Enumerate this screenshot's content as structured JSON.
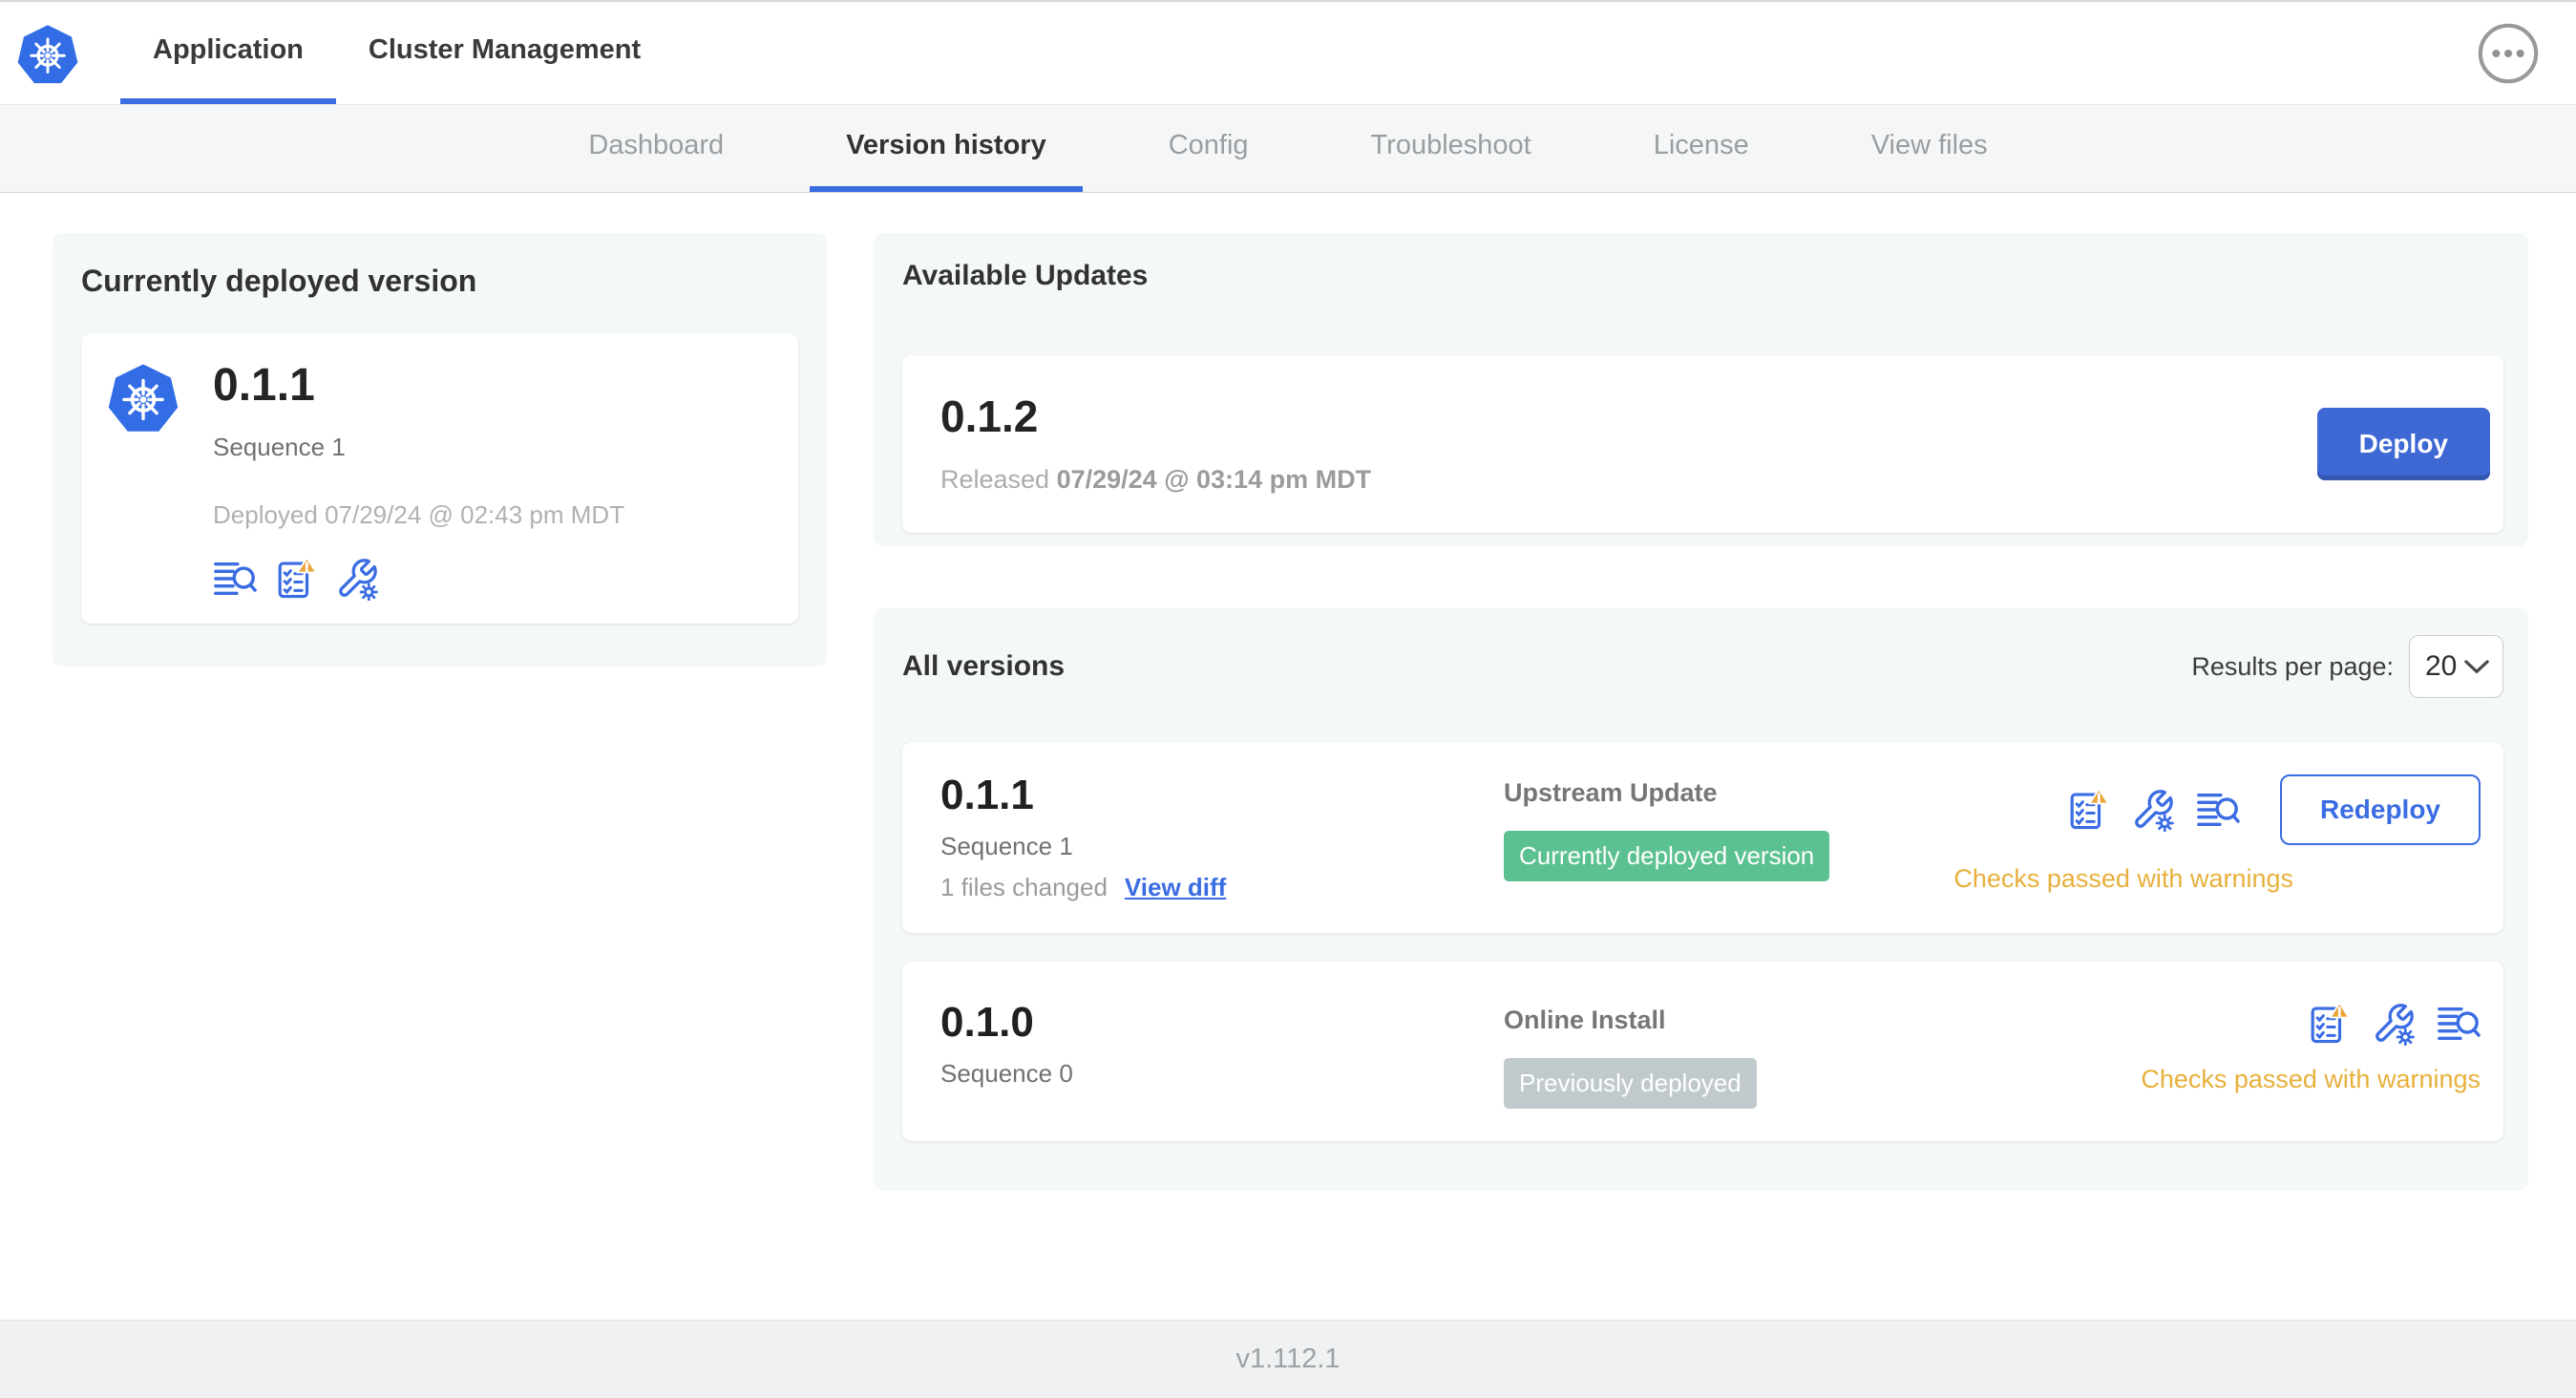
{
  "top_nav": {
    "tabs": [
      {
        "label": "Application",
        "active": true
      },
      {
        "label": "Cluster Management",
        "active": false
      }
    ]
  },
  "sub_nav": {
    "tabs": [
      {
        "label": "Dashboard",
        "active": false
      },
      {
        "label": "Version history",
        "active": true
      },
      {
        "label": "Config",
        "active": false
      },
      {
        "label": "Troubleshoot",
        "active": false
      },
      {
        "label": "License",
        "active": false
      },
      {
        "label": "View files",
        "active": false
      }
    ]
  },
  "currently_deployed": {
    "title": "Currently deployed version",
    "version": "0.1.1",
    "sequence": "Sequence 1",
    "deployed_at": "Deployed 07/29/24 @ 02:43 pm MDT"
  },
  "available_updates": {
    "title": "Available Updates",
    "version": "0.1.2",
    "released_label": "Released",
    "released_at": "07/29/24 @ 03:14 pm MDT",
    "deploy_button": "Deploy"
  },
  "all_versions": {
    "title": "All versions",
    "results_per_page_label": "Results per page:",
    "results_per_page_value": "20",
    "rows": [
      {
        "version": "0.1.1",
        "sequence": "Sequence 1",
        "files_changed": "1 files changed",
        "view_diff_link": "View diff",
        "source": "Upstream Update",
        "badge": "Currently deployed version",
        "status": "Checks passed with warnings",
        "action_button": "Redeploy"
      },
      {
        "version": "0.1.0",
        "sequence": "Sequence 0",
        "source": "Online Install",
        "badge": "Previously deployed",
        "status": "Checks passed with warnings"
      }
    ]
  },
  "footer": {
    "app_version": "v1.112.1"
  },
  "colors": {
    "primary_blue": "#3a6ce2",
    "button_blue": "#3e68d4",
    "badge_green": "#5cc191",
    "badge_gray": "#c0c9cb",
    "warning_amber": "#e7b03c",
    "panel_bg": "#f5f8f9",
    "logo_blue": "#326de6"
  }
}
